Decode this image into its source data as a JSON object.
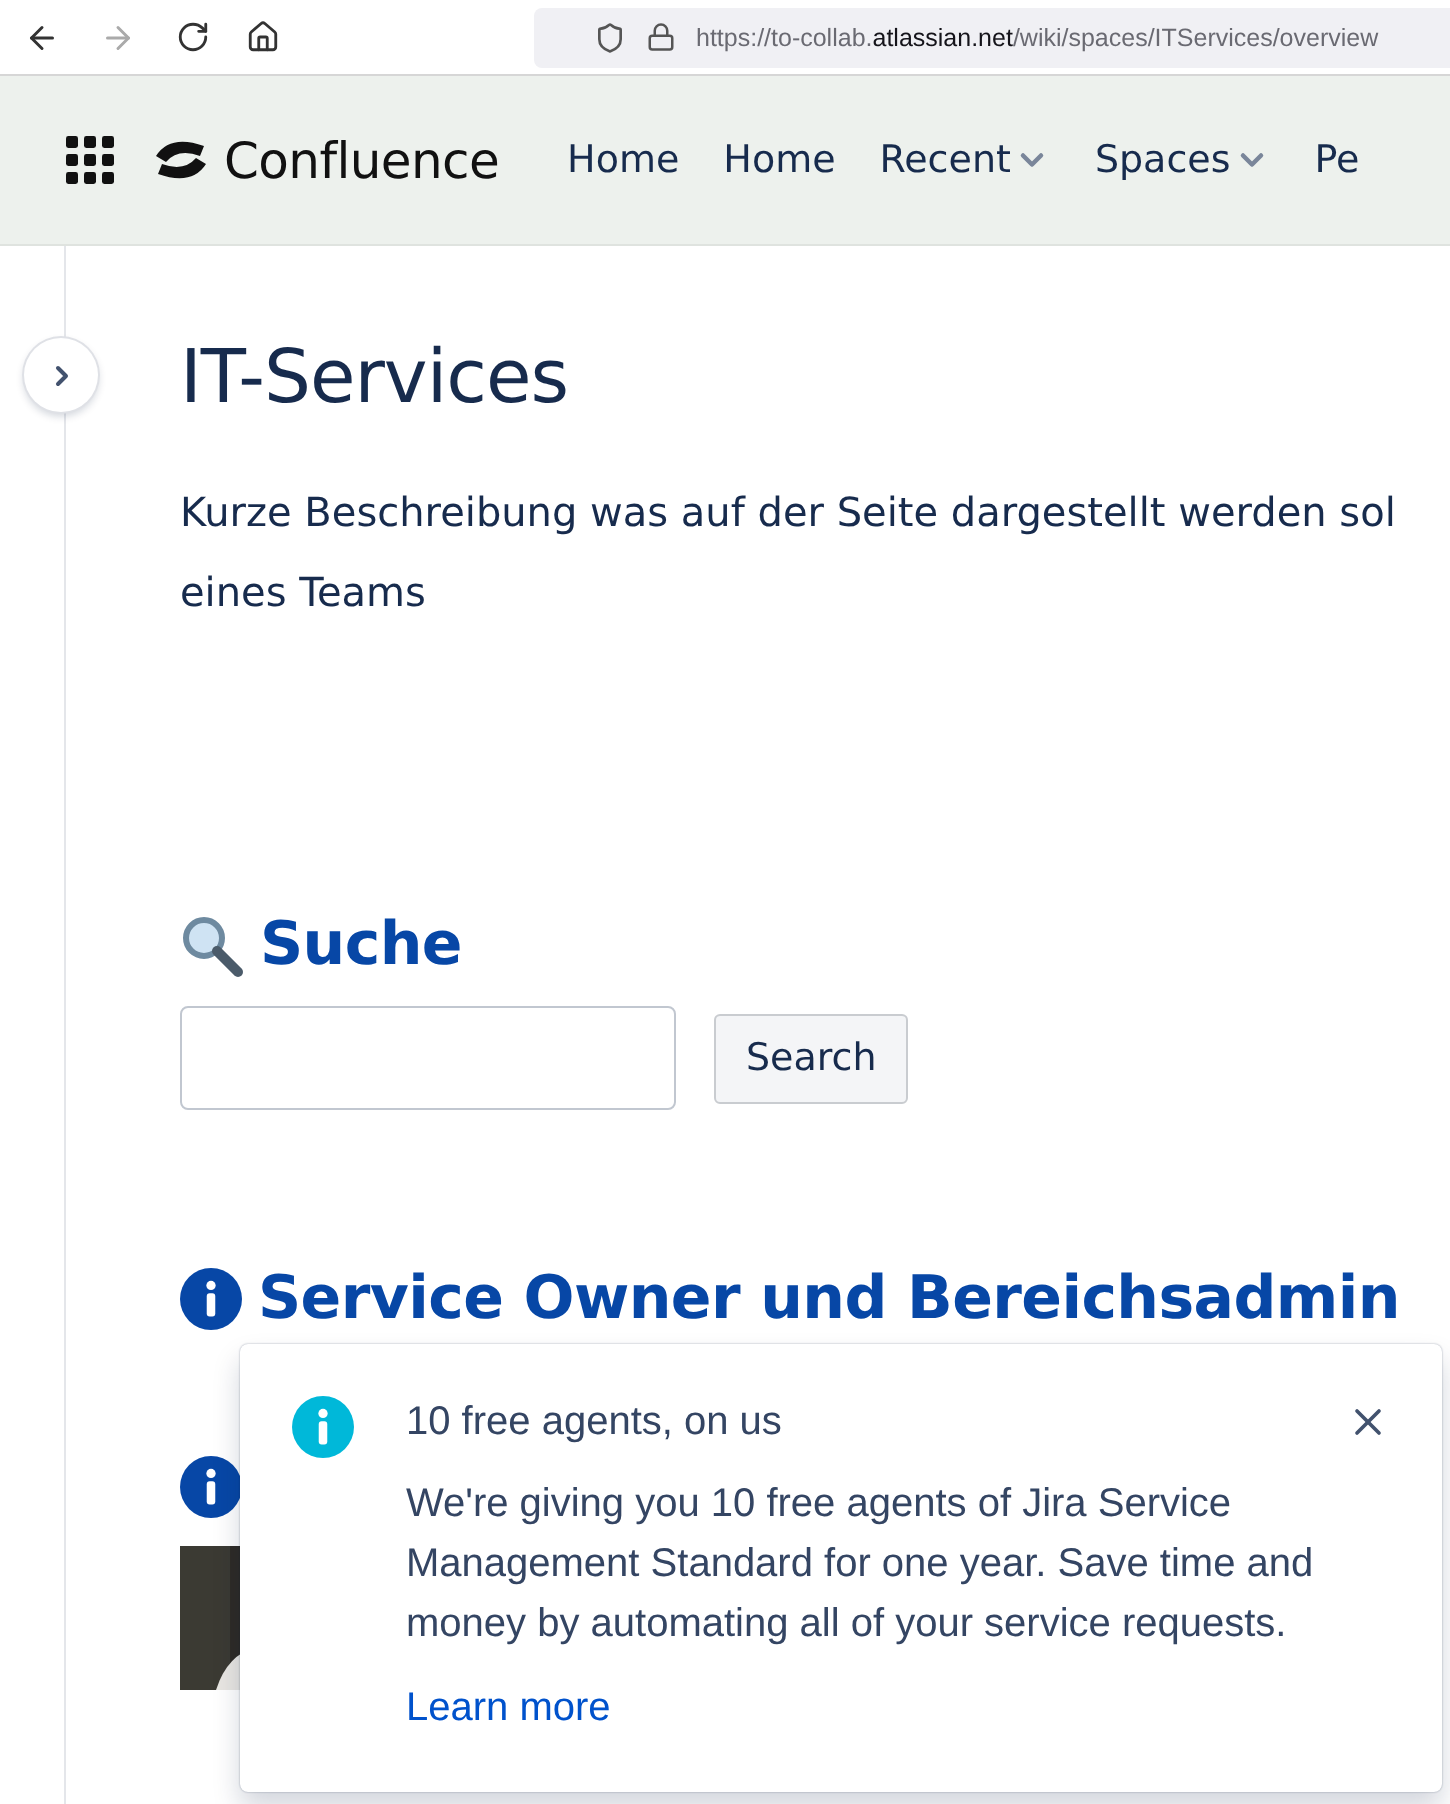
{
  "browser": {
    "url_prefix": "https://to-collab.",
    "url_domain": "atlassian.net",
    "url_path": "/wiki/spaces/ITServices/overview"
  },
  "header": {
    "product": "Confluence",
    "nav": [
      {
        "label": "Home",
        "dropdown": false
      },
      {
        "label": "Home",
        "dropdown": false
      },
      {
        "label": "Recent",
        "dropdown": true
      },
      {
        "label": "Spaces",
        "dropdown": true
      },
      {
        "label": "Pe",
        "dropdown": false
      }
    ]
  },
  "page": {
    "title": "IT-Services",
    "description": "Kurze Beschreibung was auf der Seite dargestellt werden sol\neines Teams",
    "sections": [
      {
        "kind": "search",
        "heading": "Suche",
        "button": "Search"
      },
      {
        "kind": "info",
        "heading": "Service Owner und Bereichsadmin"
      },
      {
        "kind": "info-hidden"
      },
      {
        "kind": "picture"
      }
    ]
  },
  "flag": {
    "title": "10 free agents, on us",
    "body": "We're giving you 10 free agents of Jira Service Management Standard for one year. Save time and money by automating all of your service requests.",
    "link": "Learn more"
  }
}
